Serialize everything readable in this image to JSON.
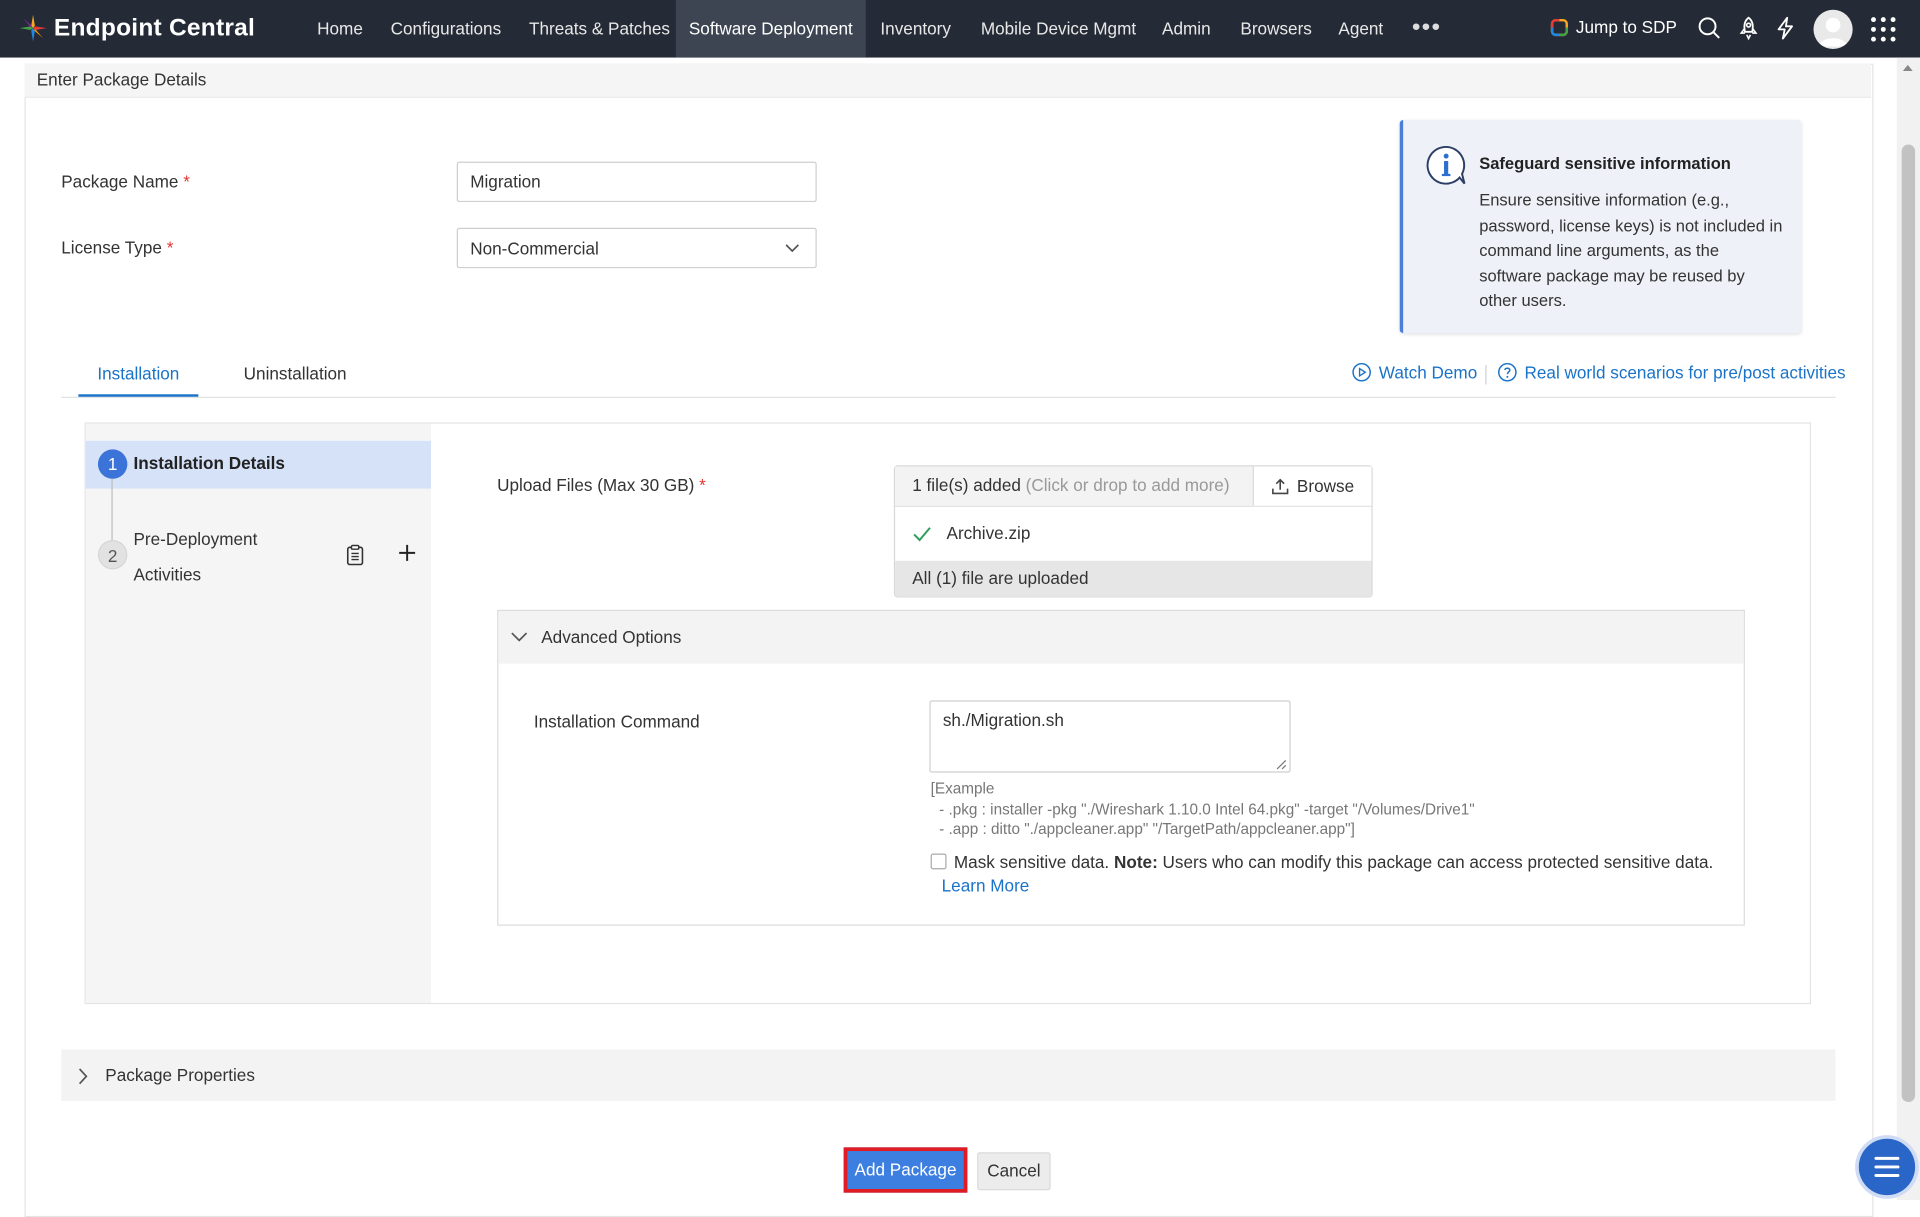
{
  "app": {
    "name": "Endpoint Central"
  },
  "nav": {
    "items": [
      {
        "label": "Home"
      },
      {
        "label": "Configurations"
      },
      {
        "label": "Threats & Patches"
      },
      {
        "label": "Software Deployment"
      },
      {
        "label": "Inventory"
      },
      {
        "label": "Mobile Device Mgmt"
      },
      {
        "label": "Admin"
      },
      {
        "label": "Browsers"
      },
      {
        "label": "Agent"
      }
    ],
    "active": "Software Deployment",
    "more": "•••",
    "jump_to_sdp": "Jump to SDP"
  },
  "panel": {
    "title": "Enter Package Details"
  },
  "form": {
    "package_name_label": "Package Name",
    "package_name_value": "Migration",
    "license_type_label": "License Type",
    "license_type_value": "Non-Commercial",
    "required_mark": "*"
  },
  "info_box": {
    "title": "Safeguard sensitive information",
    "body": "Ensure sensitive information (e.g., password, license keys) is not included in command line arguments, as the software package may be reused by other users."
  },
  "tabs": {
    "installation": "Installation",
    "uninstallation": "Uninstallation",
    "watch_demo": "Watch Demo",
    "real_world": "Real world scenarios for pre/post activities"
  },
  "steps": [
    {
      "number": "1",
      "label": "Installation Details"
    },
    {
      "number": "2",
      "label": "Pre-Deployment Activities"
    }
  ],
  "upload": {
    "label": "Upload Files (Max 30 GB)",
    "count": "1 file(s) added",
    "hint": "(Click or drop to add more)",
    "browse": "Browse",
    "file_name": "Archive.zip",
    "status": "All (1) file are uploaded"
  },
  "advanced": {
    "title": "Advanced Options",
    "command_label": "Installation Command",
    "command_value": "sh./Migration.sh",
    "example": "[Example\n  - .pkg : installer -pkg \"./Wireshark 1.10.0 Intel 64.pkg\" -target \"/Volumes/Drive1\"\n  - .app : ditto \"./appcleaner.app\" \"/TargetPath/appcleaner.app\"]",
    "mask_label": "Mask sensitive data.",
    "note_label": "Note:",
    "note_text": "Users who can modify this package can access protected sensitive data.",
    "learn_more": "Learn More",
    "mask_checked": false
  },
  "package_properties": {
    "title": "Package Properties"
  },
  "buttons": {
    "add_package": "Add Package",
    "cancel": "Cancel"
  },
  "colors": {
    "topbar": "#252b36",
    "accent": "#1a73c8",
    "primary_button": "#3d7fe0",
    "highlight_border": "#e01b24"
  }
}
